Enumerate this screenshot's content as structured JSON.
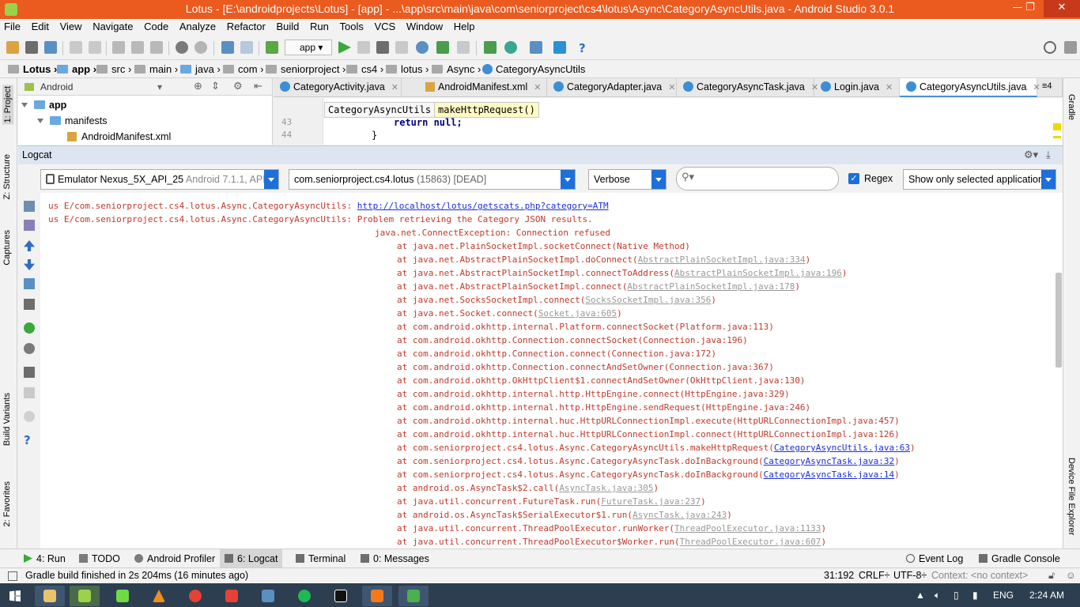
{
  "window": {
    "title": "Lotus - [E:\\androidprojects\\Lotus] - [app] - ...\\app\\src\\main\\java\\com\\seniorproject\\cs4\\lotus\\Async\\CategoryAsyncUtils.java - Android Studio 3.0.1",
    "minimize": "—",
    "maximize": "❐",
    "close": "✕"
  },
  "menu": [
    "File",
    "Edit",
    "View",
    "Navigate",
    "Code",
    "Analyze",
    "Refactor",
    "Build",
    "Run",
    "Tools",
    "VCS",
    "Window",
    "Help"
  ],
  "toolbar": {
    "run_config": "app"
  },
  "breadcrumb": [
    "Lotus",
    "app",
    "src",
    "main",
    "java",
    "com",
    "seniorproject",
    "cs4",
    "lotus",
    "Async",
    "CategoryAsyncUtils"
  ],
  "left_strip": {
    "project": "1: Project",
    "structure": "Z: Structure",
    "captures": "Captures",
    "build_variants": "Build Variants",
    "favorites": "2: Favorites"
  },
  "right_strip": {
    "gradle": "Gradle",
    "device_explorer": "Device File Explorer"
  },
  "project_pane": {
    "view_mode": "Android",
    "tree": [
      {
        "label": "app",
        "level": 0,
        "expanded": true
      },
      {
        "label": "manifests",
        "level": 1,
        "expanded": true
      },
      {
        "label": "AndroidManifest.xml",
        "level": 2,
        "expanded": false
      }
    ]
  },
  "editor_tabs": [
    {
      "label": "CategoryActivity.java",
      "active": false
    },
    {
      "label": "AndroidManifest.xml",
      "active": false
    },
    {
      "label": "CategoryAdapter.java",
      "active": false
    },
    {
      "label": "CategoryAsyncTask.java",
      "active": false
    },
    {
      "label": "Login.java",
      "active": false
    },
    {
      "label": "CategoryAsyncUtils.java",
      "active": true
    }
  ],
  "tabs_overflow": "≡4",
  "editor": {
    "breadcrumb_class": "CategoryAsyncUtils",
    "breadcrumb_method": "makeHttpRequest()",
    "lines": [
      {
        "num": "43",
        "code": "return null;"
      },
      {
        "num": "44",
        "code": "}"
      }
    ]
  },
  "logcat": {
    "title": "Logcat",
    "device": "Emulator Nexus_5X_API_25",
    "device_detail": "Android 7.1.1, API 25",
    "process": "com.seniorproject.cs4.lotus",
    "process_detail": "(15863) [DEAD]",
    "level": "Verbose",
    "search": "",
    "regex_label": "Regex",
    "filter": "Show only selected application",
    "lines": [
      {
        "prefix": "us E/com.seniorproject.cs4.lotus.Async.CategoryAsyncUtils: ",
        "text": "",
        "link": "http://localhost/lotus/getscats.php?category=ATM",
        "suffix": "",
        "link_style": "blue",
        "indent": 0
      },
      {
        "prefix": "us E/com.seniorproject.cs4.lotus.Async.CategoryAsyncUtils: ",
        "text": "Problem retrieving the Category JSON results.",
        "link": "",
        "suffix": "",
        "link_style": "",
        "indent": 0
      },
      {
        "prefix": "",
        "text": "java.net.ConnectException: Connection refused",
        "link": "",
        "suffix": "",
        "link_style": "",
        "indent": 1
      },
      {
        "prefix": "",
        "text": "at java.net.PlainSocketImpl.socketConnect(Native Method)",
        "link": "",
        "suffix": "",
        "link_style": "",
        "indent": 2
      },
      {
        "prefix": "",
        "text": "at java.net.AbstractPlainSocketImpl.doConnect(",
        "link": "AbstractPlainSocketImpl.java:334",
        "suffix": ")",
        "link_style": "gray",
        "indent": 2
      },
      {
        "prefix": "",
        "text": "at java.net.AbstractPlainSocketImpl.connectToAddress(",
        "link": "AbstractPlainSocketImpl.java:196",
        "suffix": ")",
        "link_style": "gray",
        "indent": 2
      },
      {
        "prefix": "",
        "text": "at java.net.AbstractPlainSocketImpl.connect(",
        "link": "AbstractPlainSocketImpl.java:178",
        "suffix": ")",
        "link_style": "gray",
        "indent": 2
      },
      {
        "prefix": "",
        "text": "at java.net.SocksSocketImpl.connect(",
        "link": "SocksSocketImpl.java:356",
        "suffix": ")",
        "link_style": "gray",
        "indent": 2
      },
      {
        "prefix": "",
        "text": "at java.net.Socket.connect(",
        "link": "Socket.java:605",
        "suffix": ")",
        "link_style": "gray",
        "indent": 2
      },
      {
        "prefix": "",
        "text": "at com.android.okhttp.internal.Platform.connectSocket(Platform.java:113)",
        "link": "",
        "suffix": "",
        "link_style": "",
        "indent": 2
      },
      {
        "prefix": "",
        "text": "at com.android.okhttp.Connection.connectSocket(Connection.java:196)",
        "link": "",
        "suffix": "",
        "link_style": "",
        "indent": 2
      },
      {
        "prefix": "",
        "text": "at com.android.okhttp.Connection.connect(Connection.java:172)",
        "link": "",
        "suffix": "",
        "link_style": "",
        "indent": 2
      },
      {
        "prefix": "",
        "text": "at com.android.okhttp.Connection.connectAndSetOwner(Connection.java:367)",
        "link": "",
        "suffix": "",
        "link_style": "",
        "indent": 2
      },
      {
        "prefix": "",
        "text": "at com.android.okhttp.OkHttpClient$1.connectAndSetOwner(OkHttpClient.java:130)",
        "link": "",
        "suffix": "",
        "link_style": "",
        "indent": 2
      },
      {
        "prefix": "",
        "text": "at com.android.okhttp.internal.http.HttpEngine.connect(HttpEngine.java:329)",
        "link": "",
        "suffix": "",
        "link_style": "",
        "indent": 2
      },
      {
        "prefix": "",
        "text": "at com.android.okhttp.internal.http.HttpEngine.sendRequest(HttpEngine.java:246)",
        "link": "",
        "suffix": "",
        "link_style": "",
        "indent": 2
      },
      {
        "prefix": "",
        "text": "at com.android.okhttp.internal.huc.HttpURLConnectionImpl.execute(HttpURLConnectionImpl.java:457)",
        "link": "",
        "suffix": "",
        "link_style": "",
        "indent": 2
      },
      {
        "prefix": "",
        "text": "at com.android.okhttp.internal.huc.HttpURLConnectionImpl.connect(HttpURLConnectionImpl.java:126)",
        "link": "",
        "suffix": "",
        "link_style": "",
        "indent": 2
      },
      {
        "prefix": "",
        "text": "at com.seniorproject.cs4.lotus.Async.CategoryAsyncUtils.makeHttpRequest(",
        "link": "CategoryAsyncUtils.java:63",
        "suffix": ")",
        "link_style": "blue",
        "indent": 2
      },
      {
        "prefix": "",
        "text": "at com.seniorproject.cs4.lotus.Async.CategoryAsyncTask.doInBackground(",
        "link": "CategoryAsyncTask.java:32",
        "suffix": ")",
        "link_style": "blue",
        "indent": 2
      },
      {
        "prefix": "",
        "text": "at com.seniorproject.cs4.lotus.Async.CategoryAsyncTask.doInBackground(",
        "link": "CategoryAsyncTask.java:14",
        "suffix": ")",
        "link_style": "blue",
        "indent": 2
      },
      {
        "prefix": "",
        "text": "at android.os.AsyncTask$2.call(",
        "link": "AsyncTask.java:305",
        "suffix": ")",
        "link_style": "gray",
        "indent": 2
      },
      {
        "prefix": "",
        "text": "at java.util.concurrent.FutureTask.run(",
        "link": "FutureTask.java:237",
        "suffix": ")",
        "link_style": "gray",
        "indent": 2
      },
      {
        "prefix": "",
        "text": "at android.os.AsyncTask$SerialExecutor$1.run(",
        "link": "AsyncTask.java:243",
        "suffix": ")",
        "link_style": "gray",
        "indent": 2
      },
      {
        "prefix": "",
        "text": "at java.util.concurrent.ThreadPoolExecutor.runWorker(",
        "link": "ThreadPoolExecutor.java:1133",
        "suffix": ")",
        "link_style": "gray",
        "indent": 2
      },
      {
        "prefix": "",
        "text": "at java.util.concurrent.ThreadPoolExecutor$Worker.run(",
        "link": "ThreadPoolExecutor.java:607",
        "suffix": ")",
        "link_style": "gray",
        "indent": 2
      }
    ]
  },
  "bottom_tabs": [
    {
      "label": "4: Run",
      "active": false
    },
    {
      "label": "TODO",
      "active": false
    },
    {
      "label": "Android Profiler",
      "active": false
    },
    {
      "label": "6: Logcat",
      "active": true
    },
    {
      "label": "Terminal",
      "active": false
    },
    {
      "label": "0: Messages",
      "active": false
    }
  ],
  "bottom_right_tabs": {
    "event_log": "Event Log",
    "gradle_console": "Gradle Console"
  },
  "status": {
    "message": "Gradle build finished in 2s 204ms (16 minutes ago)",
    "position": "31:192",
    "line_sep": "CRLF÷",
    "encoding": "UTF-8÷",
    "context": "Context: <no context>"
  },
  "taskbar": {
    "language": "ENG",
    "time": "2:24 AM"
  },
  "colors": {
    "title_bar": "#eb5a1e",
    "log_error": "#c0392b",
    "link_blue": "#1a2ed8",
    "taskbar": "#2d3e50",
    "accent": "#1e6fd9"
  }
}
